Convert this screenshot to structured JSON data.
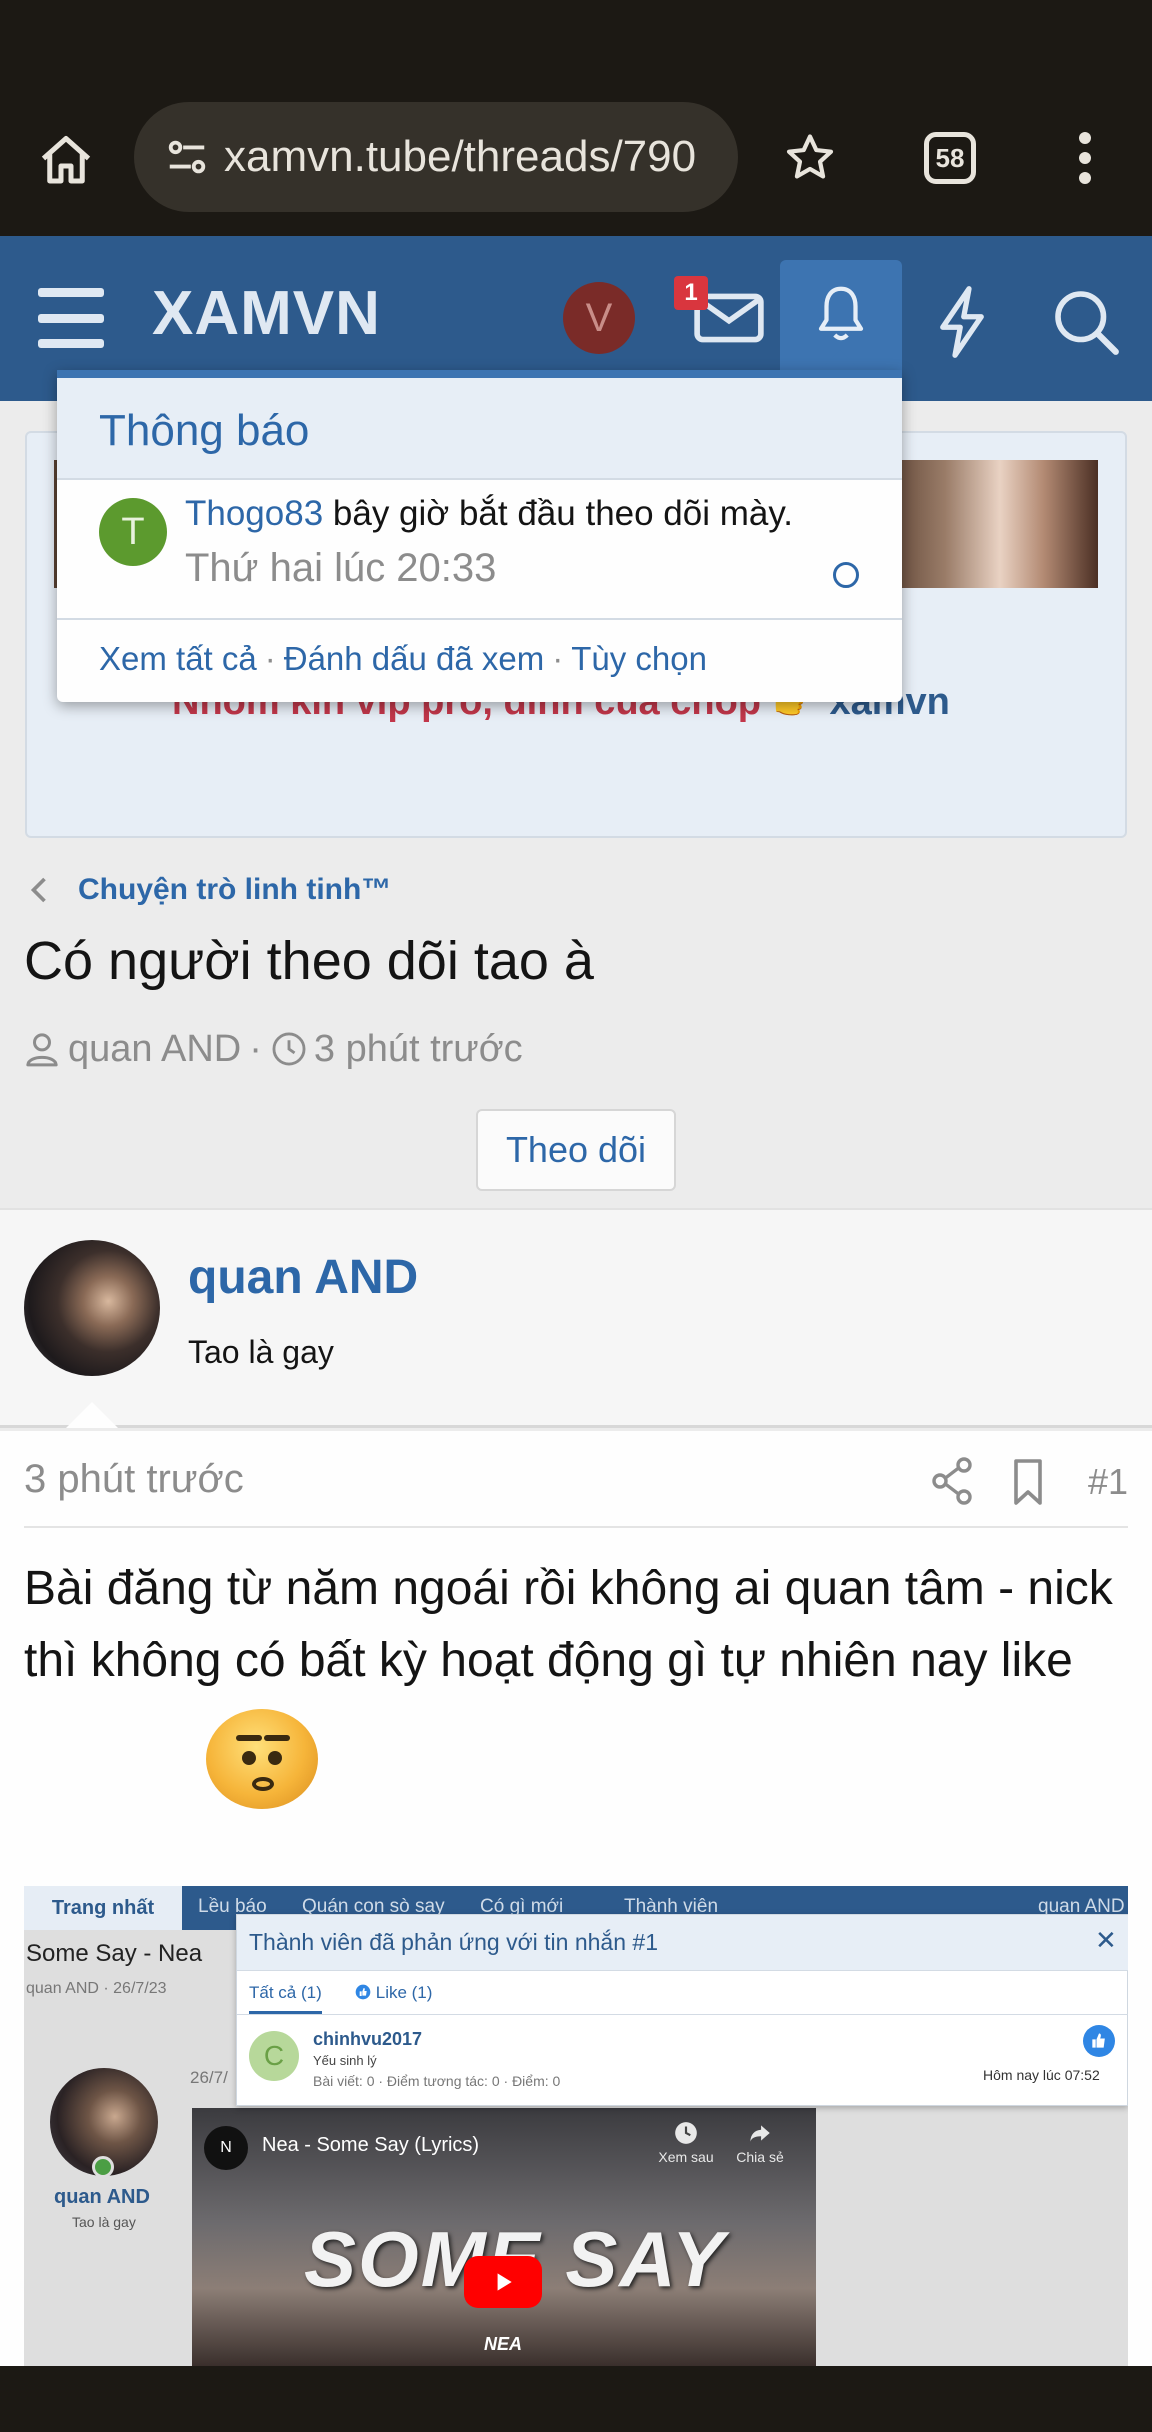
{
  "browser": {
    "url": "xamvn.tube/threads/790",
    "tab_count": "58"
  },
  "header": {
    "logo": "XAMVN",
    "avatar_letter": "V",
    "inbox_badge": "1"
  },
  "alerts": {
    "title": "Thông báo",
    "item": {
      "avatar_letter": "T",
      "user": "Thogo83",
      "text": " bây giờ bắt đầu theo dõi mày.",
      "time": "Thứ hai lúc 20:33"
    },
    "footer": {
      "view_all": "Xem tất cả",
      "mark_read": "Đánh dấu đã xem",
      "preferences": "Tùy chọn",
      "separator": "·"
    }
  },
  "banner": {
    "text": "Nhóm kín vip pro, đỉnh của chóp 👉 ",
    "brand": "xamvn"
  },
  "thread": {
    "breadcrumb": "Chuyện trò linh tinh™",
    "title": "Có người theo dõi tao à",
    "author": "quan AND",
    "meta_separator": "·",
    "time": "3 phút trước",
    "follow_label": "Theo dõi"
  },
  "post": {
    "username": "quan AND",
    "user_title": "Tao là gay",
    "time": "3 phút trước",
    "number": "#1",
    "text": "Bài đăng từ năm ngoái rồi không ai quan tâm - nick thì không có bất kỳ hoạt động gì tự nhiên nay like"
  },
  "embedded": {
    "nav_active": "Trang nhất",
    "nav_items": [
      "Lều báo",
      "Quán con sò say",
      "Có gì mới",
      "Thành viên"
    ],
    "nav_user": "quan AND",
    "page_title": "Some Say - Nea",
    "page_meta": "quan AND · 26/7/23",
    "left_name": "quan AND",
    "left_title": "Tao là gay",
    "post_date": "26/7/",
    "video": {
      "logo": "N",
      "title": "Nea - Some Say (Lyrics)",
      "watch_later": "Xem sau",
      "share": "Chia sẻ",
      "big_text": "SOME SAY",
      "small_text": "NEA"
    },
    "reactions": {
      "title": "Thành viên đã phản ứng với tin nhắn #1",
      "close": "✕",
      "tab_all": "Tất cả (1)",
      "tab_like": "Like (1)",
      "user_letter": "C",
      "user": "chinhvu2017",
      "rank": "Yếu sinh lý",
      "stats": "Bài viết: 0 · Điểm tương tác: 0 · Điểm: 0",
      "time": "Hôm nay lúc 07:52"
    }
  }
}
